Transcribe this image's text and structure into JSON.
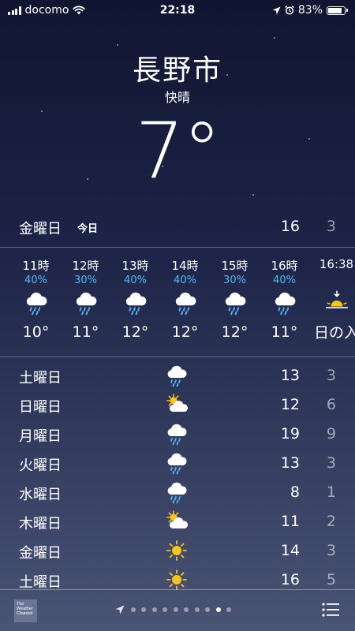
{
  "status_bar": {
    "carrier": "docomo",
    "time": "22:18",
    "battery": "83%",
    "battery_level": 0.83
  },
  "header": {
    "city": "長野市",
    "condition": "快晴",
    "temperature": "7°"
  },
  "today": {
    "day": "金曜日",
    "label": "今日",
    "high": "16",
    "low": "3"
  },
  "hourly": [
    {
      "time": "11時",
      "precip": "40%",
      "icon": "rain-cloud-icon",
      "temp": "10°"
    },
    {
      "time": "12時",
      "precip": "30%",
      "icon": "rain-cloud-icon",
      "temp": "11°"
    },
    {
      "time": "13時",
      "precip": "40%",
      "icon": "rain-cloud-icon",
      "temp": "12°"
    },
    {
      "time": "14時",
      "precip": "40%",
      "icon": "rain-cloud-icon",
      "temp": "12°"
    },
    {
      "time": "15時",
      "precip": "30%",
      "icon": "rain-cloud-icon",
      "temp": "12°"
    },
    {
      "time": "16時",
      "precip": "40%",
      "icon": "rain-cloud-icon",
      "temp": "11°"
    },
    {
      "time": "16:38",
      "precip": "",
      "icon": "sunset-icon",
      "temp": "日の入"
    }
  ],
  "daily": [
    {
      "day": "土曜日",
      "icon": "rain-cloud-icon",
      "high": "13",
      "low": "3"
    },
    {
      "day": "日曜日",
      "icon": "partly-cloudy-icon",
      "high": "12",
      "low": "6"
    },
    {
      "day": "月曜日",
      "icon": "rain-cloud-icon",
      "high": "19",
      "low": "9"
    },
    {
      "day": "火曜日",
      "icon": "rain-cloud-icon",
      "high": "13",
      "low": "3"
    },
    {
      "day": "水曜日",
      "icon": "rain-cloud-icon",
      "high": "8",
      "low": "1"
    },
    {
      "day": "木曜日",
      "icon": "partly-cloudy-icon",
      "high": "11",
      "low": "2"
    },
    {
      "day": "金曜日",
      "icon": "sun-icon",
      "high": "14",
      "low": "3"
    },
    {
      "day": "土曜日",
      "icon": "sun-icon",
      "high": "16",
      "low": "5"
    }
  ],
  "bottom_bar": {
    "logo_text": "The Weather Channel",
    "page_count": 10,
    "active_page": 9
  },
  "colors": {
    "precip": "#55b7f3",
    "sun": "#f7c51e"
  }
}
